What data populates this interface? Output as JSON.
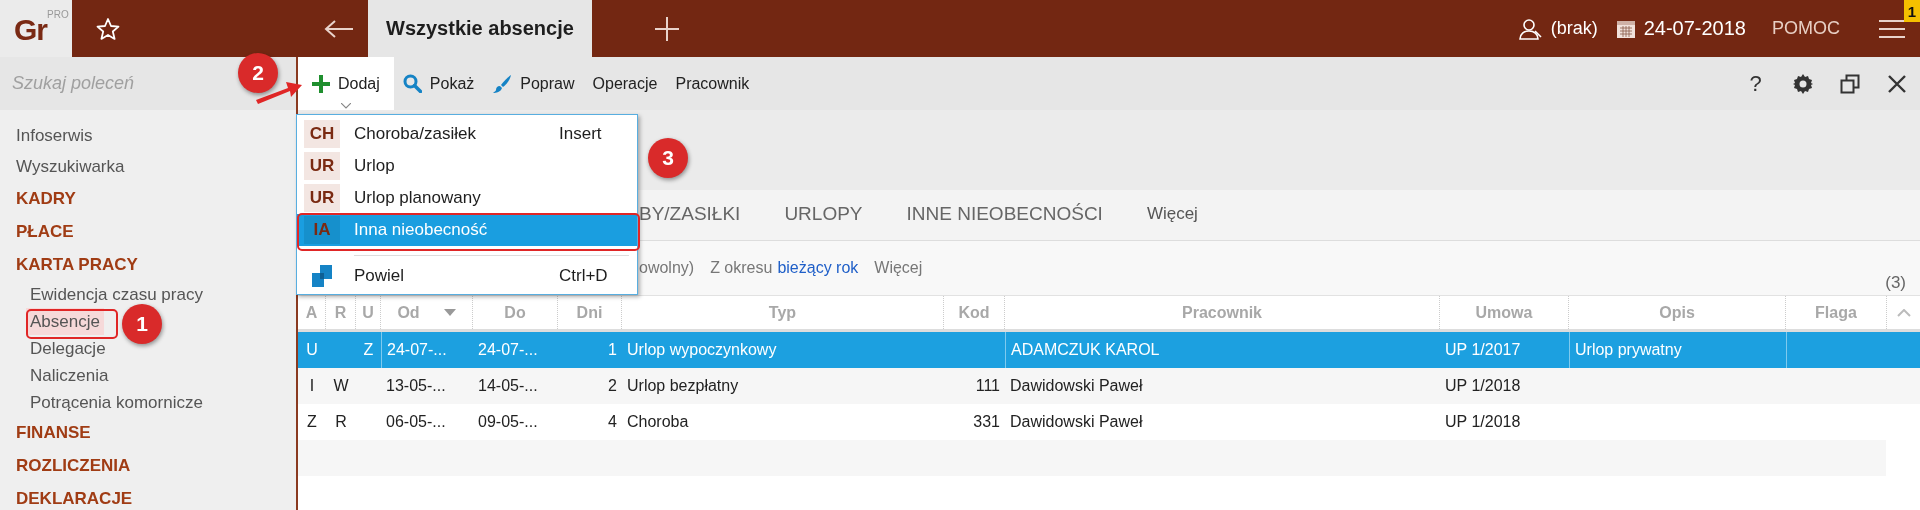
{
  "logo": {
    "text": "Gr",
    "edition": "PRO"
  },
  "tabs": [
    {
      "label": "Wszystkie absencje",
      "selected": true
    }
  ],
  "status": {
    "user": "(brak)",
    "date": "24-07-2018",
    "help": "POMOC",
    "notifications": "1"
  },
  "search": {
    "placeholder": "Szukaj poleceń"
  },
  "toolbar": [
    {
      "label": "Dodaj",
      "selected": true
    },
    {
      "label": "Pokaż",
      "selected": false
    },
    {
      "label": "Popraw",
      "selected": false
    },
    {
      "label": "Operacje",
      "selected": false
    },
    {
      "label": "Pracownik",
      "selected": false
    }
  ],
  "window_controls": {
    "help": "?"
  },
  "sidebar": {
    "items": [
      {
        "label": "Infoserwis",
        "kind": "link",
        "selected": false
      },
      {
        "label": "Wyszukiwarka",
        "kind": "link",
        "selected": false
      },
      {
        "label": "KADRY",
        "kind": "section",
        "selected": false
      },
      {
        "label": "PŁACE",
        "kind": "section",
        "selected": false
      },
      {
        "label": "KARTA PRACY",
        "kind": "section",
        "selected": false,
        "children": [
          {
            "label": "Ewidencja czasu pracy",
            "selected": false
          },
          {
            "label": "Absencje",
            "selected": true
          },
          {
            "label": "Delegacje",
            "selected": false
          },
          {
            "label": "Naliczenia",
            "selected": false
          },
          {
            "label": "Potrącenia komornicze",
            "selected": false
          }
        ]
      },
      {
        "label": "FINANSE",
        "kind": "section",
        "selected": false
      },
      {
        "label": "ROZLICZENIA",
        "kind": "section",
        "selected": false
      },
      {
        "label": "DEKLARACJE",
        "kind": "section",
        "selected": false
      }
    ]
  },
  "dropdown": {
    "items": [
      {
        "kind": "code",
        "code": "CH",
        "label": "Choroba/zasiłek",
        "shortcut": "Insert",
        "selected": false
      },
      {
        "kind": "code",
        "code": "UR",
        "label": "Urlop",
        "selected": false
      },
      {
        "kind": "code",
        "code": "UR",
        "label": "Urlop planowany",
        "selected": false
      },
      {
        "kind": "code",
        "code": "IA",
        "label": "Inna nieobecność",
        "selected": true
      },
      {
        "kind": "separator"
      },
      {
        "kind": "icon",
        "label": "Powiel",
        "shortcut": "Ctrl+D",
        "selected": false
      }
    ]
  },
  "view_tabs": [
    {
      "label": "BY/ZASIŁKI",
      "selected": false
    },
    {
      "label": "URLOPY",
      "selected": false
    },
    {
      "label": "INNE NIEOBECNOŚCI",
      "selected": false
    }
  ],
  "view_more": "Więcej",
  "filter": {
    "text": "owolny)",
    "period_label": "Z okresu",
    "period": "bieżący rok",
    "more": "Więcej",
    "count": "(3)"
  },
  "table": {
    "columns": [
      {
        "label": "A",
        "sorted": false
      },
      {
        "label": "R",
        "sorted": false
      },
      {
        "label": "U",
        "sorted": false
      },
      {
        "label": "Od",
        "sorted": true
      },
      {
        "label": "Do",
        "sorted": false
      },
      {
        "label": "Dni",
        "sorted": false
      },
      {
        "label": "Typ",
        "sorted": false
      },
      {
        "label": "Kod",
        "sorted": false
      },
      {
        "label": "Pracownik",
        "sorted": false
      },
      {
        "label": "Umowa",
        "sorted": false
      },
      {
        "label": "Opis",
        "sorted": false
      },
      {
        "label": "Flaga",
        "sorted": false
      }
    ],
    "rows": [
      {
        "selected": true,
        "cells": [
          "U",
          null,
          "Z",
          "24-07-...",
          "24-07-...",
          "1",
          "Urlop wypoczynkowy",
          null,
          "ADAMCZUK KAROL",
          "UP 1/2017",
          "Urlop prywatny",
          null
        ]
      },
      {
        "selected": false,
        "cells": [
          "I",
          "W",
          null,
          "13-05-...",
          "14-05-...",
          "2",
          "Urlop bezpłatny",
          "111",
          "Dawidowski Paweł",
          "UP 1/2018",
          null,
          null
        ]
      },
      {
        "selected": false,
        "cells": [
          "Z",
          "R",
          null,
          "06-05-...",
          "09-05-...",
          "4",
          "Choroba",
          "331",
          "Dawidowski Paweł",
          "UP 1/2018",
          null,
          null
        ]
      }
    ]
  },
  "annotations": [
    {
      "label": "1"
    },
    {
      "label": "2"
    },
    {
      "label": "3"
    }
  ]
}
